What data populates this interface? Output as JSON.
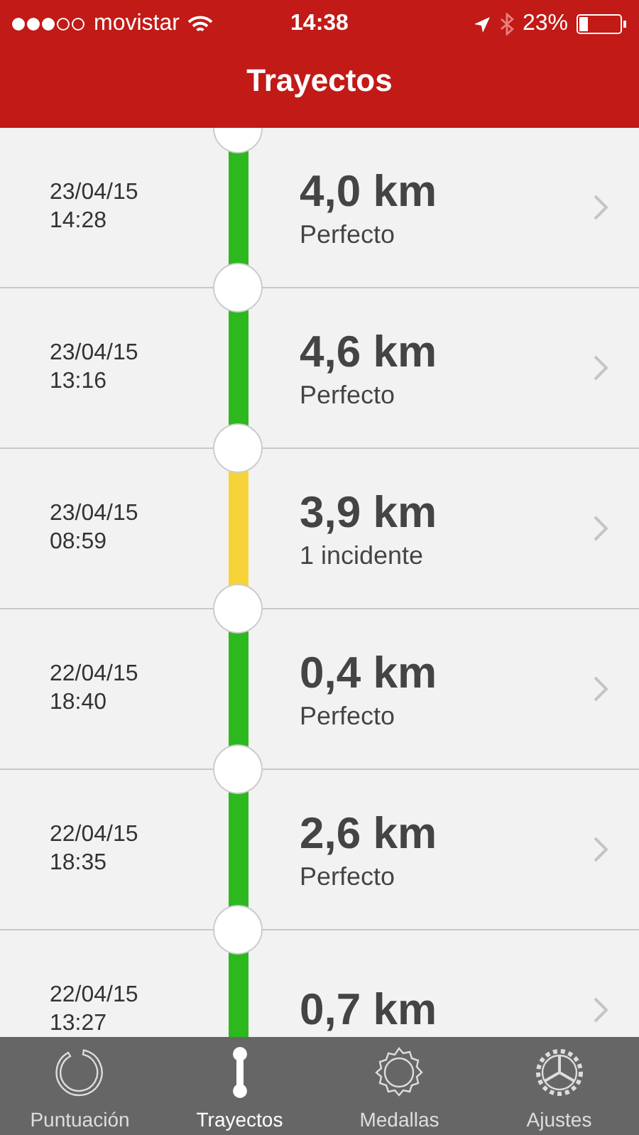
{
  "status_bar": {
    "carrier": "movistar",
    "time": "14:38",
    "battery": "23%"
  },
  "title": "Trayectos",
  "trips": [
    {
      "date": "23/04/15",
      "time": "14:28",
      "distance": "4,0 km",
      "status": "Perfecto",
      "color": "#2db81f"
    },
    {
      "date": "23/04/15",
      "time": "13:16",
      "distance": "4,6 km",
      "status": "Perfecto",
      "color": "#2db81f"
    },
    {
      "date": "23/04/15",
      "time": "08:59",
      "distance": "3,9 km",
      "status": "1 incidente",
      "color": "#f7d33a"
    },
    {
      "date": "22/04/15",
      "time": "18:40",
      "distance": "0,4 km",
      "status": "Perfecto",
      "color": "#2db81f"
    },
    {
      "date": "22/04/15",
      "time": "18:35",
      "distance": "2,6 km",
      "status": "Perfecto",
      "color": "#2db81f"
    },
    {
      "date": "22/04/15",
      "time": "13:27",
      "distance": "0,7 km",
      "color": "#2db81f"
    }
  ],
  "tabs": [
    {
      "label": "Puntuación",
      "kind": "score",
      "selected": false
    },
    {
      "label": "Trayectos",
      "kind": "trips",
      "selected": true
    },
    {
      "label": "Medallas",
      "kind": "medals",
      "selected": false
    },
    {
      "label": "Ajustes",
      "kind": "settings",
      "selected": false
    }
  ]
}
